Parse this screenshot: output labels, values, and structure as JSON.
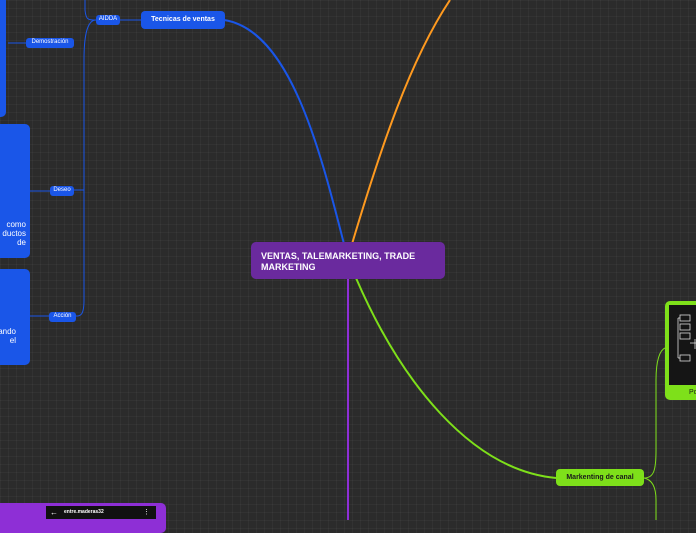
{
  "central": {
    "title": "VENTAS, TALEMARKETING, TRADE MARKETING"
  },
  "branches": {
    "tecnicas": {
      "label": "Tecnicas de ventas"
    },
    "aidda": {
      "label": "AIDDA"
    },
    "demostracion": {
      "label": "Demostración"
    },
    "deseo": {
      "label": "Deseo"
    },
    "accion": {
      "label": "Acción"
    },
    "canal": {
      "label": "Markenting de canal"
    }
  },
  "fragments": {
    "deseo_text": [
      "como",
      "ductos",
      "de"
    ],
    "accion_text": [
      "ando",
      "el"
    ],
    "green_card_label": "Po",
    "purple_bar_title": "entre.maderas32"
  },
  "colors": {
    "central": "#6a2a9e",
    "blue": "#1a56e8",
    "orange": "#ff9a1f",
    "green": "#7ee01a",
    "purple": "#8e2fd6",
    "background": "#2b2b2b"
  },
  "icons": [
    "back-arrow-icon",
    "more-vert-icon",
    "flowchart-icon"
  ]
}
